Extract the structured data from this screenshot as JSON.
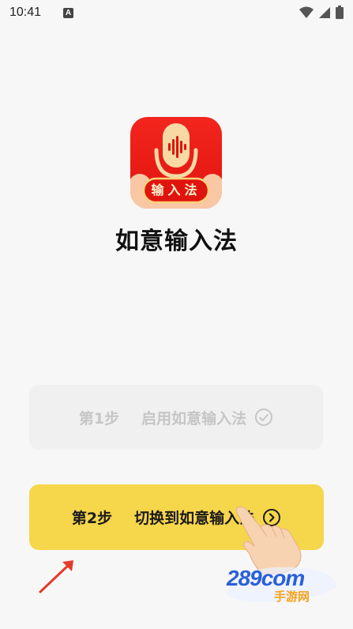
{
  "status_bar": {
    "time": "10:41",
    "notification_icon": "a-icon",
    "right_icons": [
      "wifi-icon",
      "signal-icon",
      "battery-icon"
    ]
  },
  "app": {
    "logo_badge_text": "输入法",
    "name": "如意输入法"
  },
  "steps": {
    "step1": {
      "prefix": "第1步",
      "label": "启用如意输入法",
      "icon": "check-circle-icon",
      "state": "completed"
    },
    "step2": {
      "prefix": "第2步",
      "label": "切换到如意输入法",
      "icon": "arrow-right-circle-icon",
      "state": "active"
    }
  },
  "watermark": {
    "line1": "289com",
    "line2": "手游网"
  },
  "colors": {
    "background": "#f7f7f7",
    "logo_red": "#e0140e",
    "logo_gold": "#f7d27a",
    "step1_bg": "#f0f0f0",
    "step1_text": "#c6c6c6",
    "step2_bg": "#f6d64b",
    "arrow_red": "#e53a2b",
    "watermark_blue": "#2a5fd8",
    "watermark_orange": "#f7a21b"
  }
}
